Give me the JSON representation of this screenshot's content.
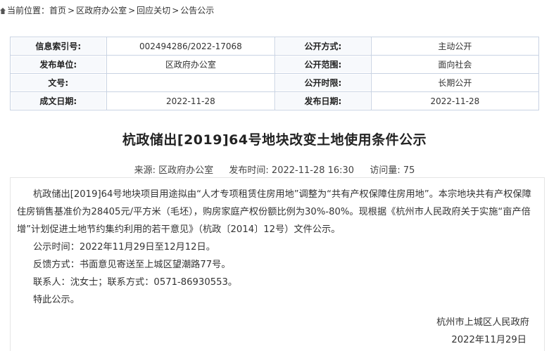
{
  "breadcrumb": {
    "prefix": "当前位置：",
    "items": [
      "首页",
      "区政府办公室",
      "回应关切",
      "公告公示"
    ],
    "separator": ">"
  },
  "meta": {
    "rows": [
      {
        "label1": "信息索引号:",
        "value1": "002494286/2022-17068",
        "label2": "公开方式:",
        "value2": "主动公开"
      },
      {
        "label1": "发布单位:",
        "value1": "区政府办公室",
        "label2": "公开范围:",
        "value2": "面向社会"
      },
      {
        "label1": "文号:",
        "value1": "",
        "label2": "公开时限:",
        "value2": "长期公开"
      },
      {
        "label1": "成文日期:",
        "value1": "2022-11-28",
        "label2": "发布日期:",
        "value2": "2022-11-28"
      }
    ]
  },
  "article": {
    "title": "杭政储出[2019]64号地块改变土地使用条件公示",
    "source_label": "来源:",
    "source": "区政府办公室",
    "publish_label": "发布时间:",
    "publish_time": "2022-11-28 16:30",
    "views_label": "访问量:",
    "views": "75",
    "paragraphs": [
      "杭政储出[2019]64号地块项目用途拟由“人才专项租赁住房用地”调整为“共有产权保障住房用地”。本宗地块共有产权保障住房销售基准价为28405元/平方米（毛坯），购房家庭产权份额比例为30%-80%。现根据《杭州市人民政府关于实施“亩产倍增”计划促进土地节约集约利用的若干意见》（杭政〔2014〕12号）文件公示。",
      "公示时间：2022年11月29日至12月12日。",
      "反馈方式：书面意见寄送至上城区望潮路77号。",
      "联系人：沈女士；联系方式：0571-86930553。",
      "特此公示。"
    ],
    "signature": "杭州市上城区人民政府",
    "sign_date": "2022年11月29日"
  }
}
